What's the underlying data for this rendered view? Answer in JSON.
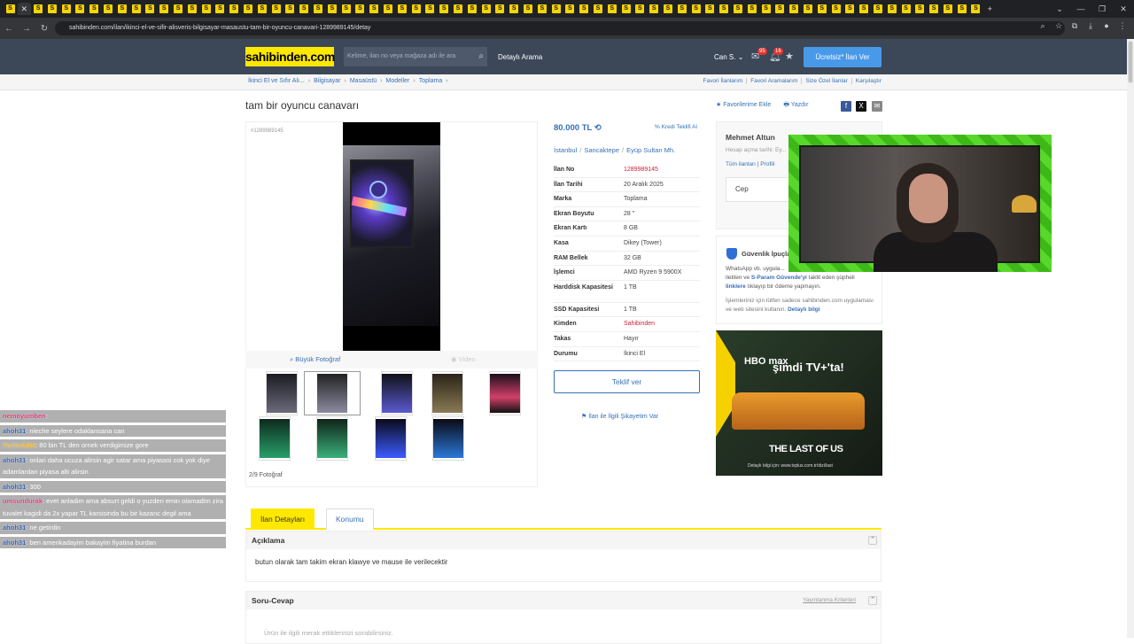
{
  "browser": {
    "tab_favicon_letter": "S",
    "tab_count": 70,
    "url": "sahibinden.com/ilan/ikinci-el-ve-sifir-alisveris-bilgisayar-masaustu-tam-bir-oyuncu-canavari-1289989145/detay"
  },
  "header": {
    "logo": "sahibinden.com",
    "search_placeholder": "Kelime, ilan no veya mağaza adı ile ara",
    "detailed_search": "Detaylı Arama",
    "user": "Can S.",
    "messages_badge": "95",
    "notifications_badge": "16",
    "post_ad": "Ücretsiz* İlan Ver"
  },
  "breadcrumb": {
    "items": [
      "İkinci El ve Sıfır Alı...",
      "Bilgisayar",
      "Masaüstü",
      "Modeller",
      "Toplama"
    ],
    "right": [
      "Favori İlanlarım",
      "Favori Aramalarım",
      "Size Özel İlanlar",
      "Karşılaştır"
    ]
  },
  "listing": {
    "title": "tam bir oyuncu canavarı",
    "add_favorite": "Favorilerime Ekle",
    "print": "Yazdır",
    "id_small": "#1289989145",
    "big_photo": "Büyük Fotoğraf",
    "video": "Video",
    "photo_count": "2/9 Fotoğraf",
    "price": "80.000 TL",
    "credit": "Kredi Teklifi Al",
    "location": [
      "İstanbul",
      "Sancaktepe",
      "Eyüp Sultan Mh."
    ],
    "attributes": [
      {
        "k": "İlan No",
        "v": "1289989145"
      },
      {
        "k": "İlan Tarihi",
        "v": "20 Aralık 2025"
      },
      {
        "k": "Marka",
        "v": "Toplama"
      },
      {
        "k": "Ekran Boyutu",
        "v": "28 \""
      },
      {
        "k": "Ekran Kartı",
        "v": "8 GB"
      },
      {
        "k": "Kasa",
        "v": "Dikey (Tower)"
      },
      {
        "k": "RAM Bellek",
        "v": "32 GB"
      },
      {
        "k": "İşlemci",
        "v": "AMD Ryzen 9 5900X"
      },
      {
        "k": "Harddisk Kapasitesi",
        "v": "1 TB"
      },
      {
        "k": "SSD Kapasitesi",
        "v": "1 TB"
      },
      {
        "k": "Kimden",
        "v": "Sahibinden"
      },
      {
        "k": "Takas",
        "v": "Hayır"
      },
      {
        "k": "Durumu",
        "v": "İkinci El"
      }
    ],
    "offer_button": "Teklif ver",
    "complaint": "İlan ile İlgili Şikayetim Var"
  },
  "seller": {
    "name": "Mehmet Altun",
    "since": "Hesap açma tarihi: Ey...",
    "links": "Tüm ilanları  |  Profili",
    "phone_label": "Cep"
  },
  "safety": {
    "title": "Güvenlik İpuçla...",
    "p1_a": "WhatsApp vb. uygula...",
    "p1_b": "iletilen ve ",
    "p1_link1": "S-Param Güvende'yi",
    "p1_c": " taklit eden şüpheli ",
    "p1_link2": "linklere",
    "p1_d": " tıklayıp bir ödeme yapmayın.",
    "p2": "İşlemleriniz için lütfen sadece sahibinden.com uygulaması ve web sitesini kullanın. ",
    "p2_link": "Detaylı bilgi"
  },
  "ad": {
    "brand": "HBO max",
    "headline": "şimdi TV+'ta!",
    "show": "THE LAST OF US",
    "more": "Detaylı bilgi için: www.tvplus.com.tr/dizi/last"
  },
  "tabs": [
    "İlan Detayları",
    "Konumu"
  ],
  "description": {
    "header": "Açıklama",
    "text": "butun olarak tam takim ekran klawye ve mause ile verilecektir"
  },
  "qa": {
    "header": "Soru-Cevap",
    "criteria": "Yayınlanma Kriterleri",
    "placeholder": "Ürün ile ilgili merak ettiklerinizi sorabilirsiniz."
  },
  "chat": [
    {
      "user": "nemoyumben",
      "msg": ":",
      "color": "#d63a7a"
    },
    {
      "user": "ahoh31",
      "msg": ": nieche seylere odaklansana can",
      "color": "#2f63b8"
    },
    {
      "user": "YarimAdet",
      "msg": ": 80 bin TL den ornek verdigimize gore",
      "color": "#e8b025"
    },
    {
      "user": "ahoh31",
      "msg": ": onlari daha ucuza alirsin agir satar ama piyasasi cok yok diye adamlardan piyasa alti alirsin",
      "color": "#2f63b8"
    },
    {
      "user": "ahoh31",
      "msg": ": 300",
      "color": "#2f63b8"
    },
    {
      "user": "umsundurak",
      "msg": ": evet anladim ama absurt geldi o yuzden emin olamadim zira tuvalet kagidi da 2x yapar TL karsisinda bu bir kazanc degil ama",
      "color": "#d63a7a"
    },
    {
      "user": "ahoh31",
      "msg": ": ne getirdin",
      "color": "#2f63b8"
    },
    {
      "user": "ahoh31",
      "msg": ": ben amerikadayim bakayim fiyatina burdan",
      "color": "#2f63b8"
    }
  ],
  "colors": {
    "brand_yellow": "#ffe800",
    "header_bg": "#3c4758",
    "link_blue": "#3770b6",
    "cta_blue": "#489ae9"
  }
}
